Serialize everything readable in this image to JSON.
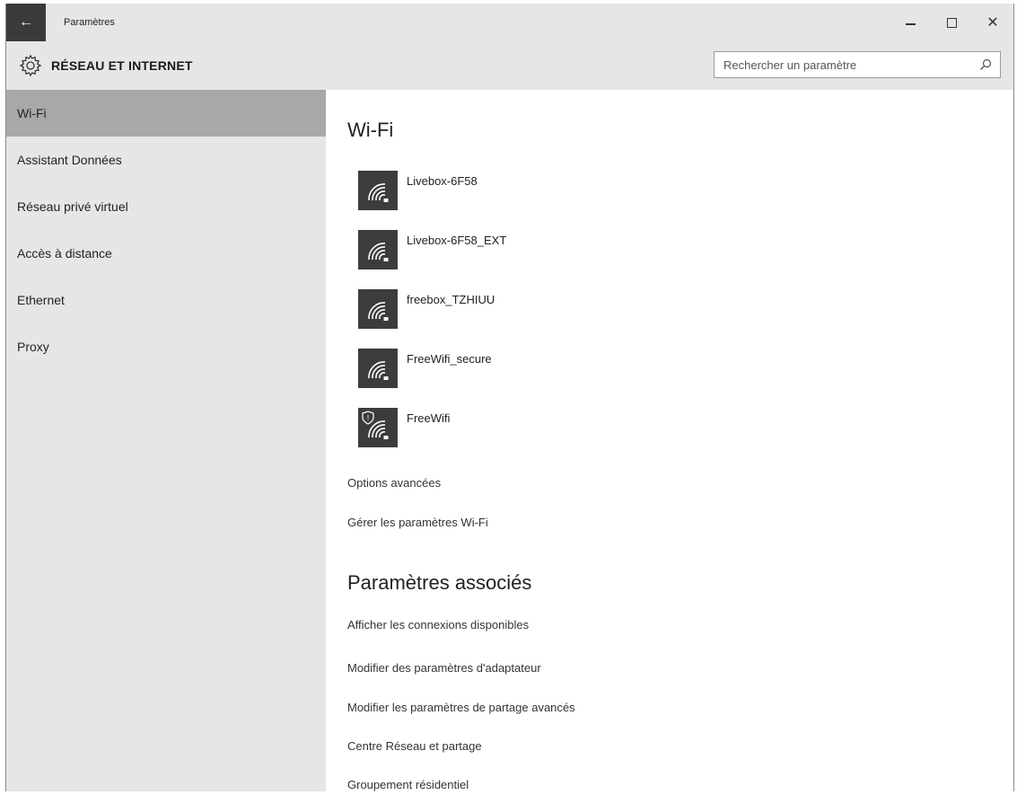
{
  "window": {
    "title": "Paramètres",
    "back_icon": "back-arrow-icon"
  },
  "header": {
    "section_title": "RÉSEAU ET INTERNET",
    "search_placeholder": "Rechercher un paramètre"
  },
  "sidebar": {
    "items": [
      {
        "label": "Wi-Fi",
        "active": true
      },
      {
        "label": "Assistant Données"
      },
      {
        "label": "Réseau privé virtuel"
      },
      {
        "label": "Accès à distance"
      },
      {
        "label": "Ethernet"
      },
      {
        "label": "Proxy"
      }
    ]
  },
  "main": {
    "wifi_heading": "Wi-Fi",
    "networks": [
      {
        "name": "Livebox-6F58",
        "secured": true
      },
      {
        "name": "Livebox-6F58_EXT",
        "secured": true
      },
      {
        "name": "freebox_TZHIUU",
        "secured": true
      },
      {
        "name": "FreeWifi_secure",
        "secured": true
      },
      {
        "name": "FreeWifi",
        "secured": false,
        "shield": true
      }
    ],
    "options_link": "Options avancées",
    "manage_link": "Gérer les paramètres Wi-Fi",
    "related_heading": "Paramètres associés",
    "related_links": [
      "Afficher les connexions disponibles",
      "Modifier des paramètres d'adaptateur",
      "Modifier les paramètres de partage avancés",
      "Centre Réseau et partage",
      "Groupement résidentiel"
    ]
  },
  "colors": {
    "sidebar_bg": "#e6e6e6",
    "active_item": "#a8a8a8",
    "icon_tile": "#3c3c3c"
  }
}
